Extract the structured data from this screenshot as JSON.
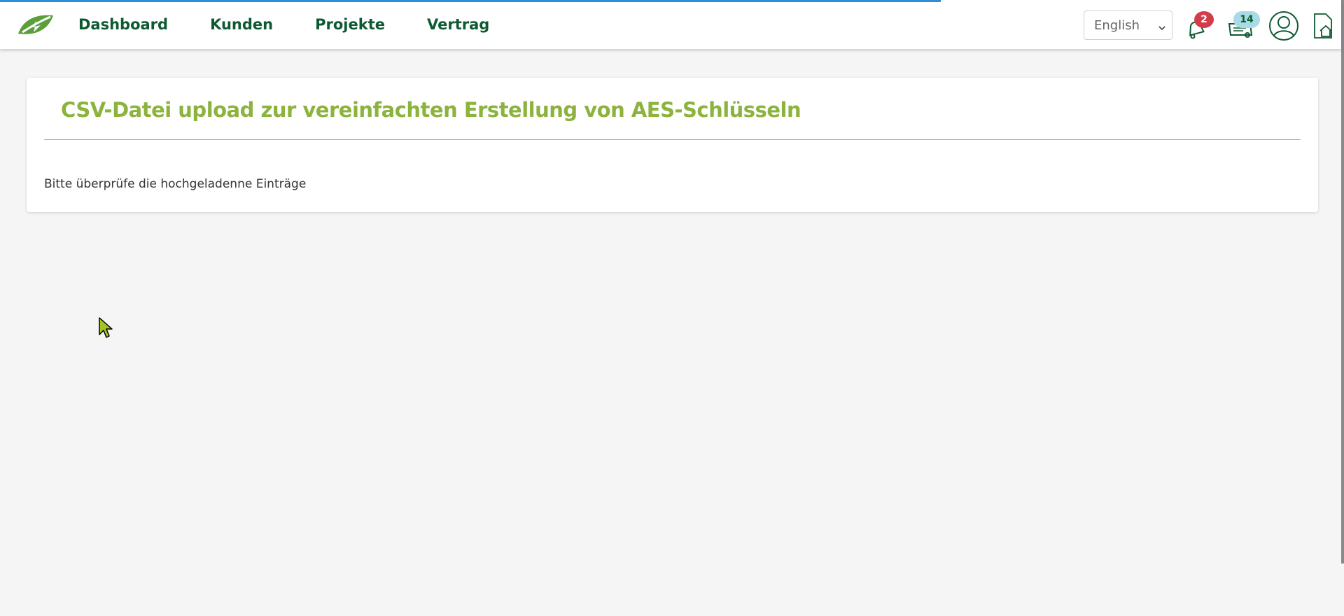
{
  "progress": {
    "fraction": 0.7
  },
  "navbar": {
    "links": [
      {
        "label": "Dashboard"
      },
      {
        "label": "Kunden"
      },
      {
        "label": "Projekte"
      },
      {
        "label": "Vertrag"
      }
    ],
    "language_select": {
      "selected": "English"
    },
    "notifications": {
      "icon": "bell-icon",
      "count": "2"
    },
    "news": {
      "icon": "news-icon",
      "count": "14"
    },
    "profile": {
      "icon": "user-avatar-icon"
    },
    "home": {
      "icon": "home-document-icon"
    }
  },
  "main": {
    "card": {
      "title": "CSV-Datei upload zur vereinfachten Erstellung von AES-Schlüsseln",
      "text": "Bitte überprüfe die hochgeladenne Einträge"
    }
  },
  "colors": {
    "brand_dark_green": "#0d5a32",
    "title_green": "#8cb33d",
    "progress_blue": "#2b8fd6",
    "badge_red": "#d23c4b",
    "badge_light_blue": "#a8dbe5"
  }
}
